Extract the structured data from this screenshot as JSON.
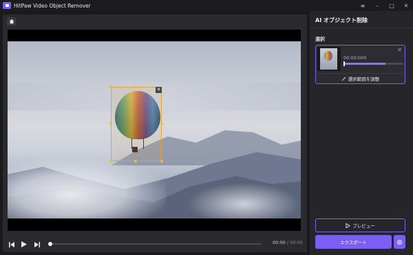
{
  "app": {
    "title": "HitPaw Video Object Remover",
    "window_controls": [
      "≡",
      "–",
      "□",
      "✕"
    ]
  },
  "player": {
    "current_time": "00:00",
    "separator": " / ",
    "duration": "00:05"
  },
  "sidebar": {
    "title": "AI オブジェクト削除",
    "section_label": "選択",
    "selection_card": {
      "time": "00:00:000",
      "adjust_label": "選択範囲を調整",
      "progress": 0.7
    },
    "preview_label": "プレビュー",
    "export_label": "エクスポート"
  },
  "colors": {
    "accent": "#7b5ff5",
    "selection_handles": "#f0b64a",
    "panel_bg": "#25252a"
  }
}
